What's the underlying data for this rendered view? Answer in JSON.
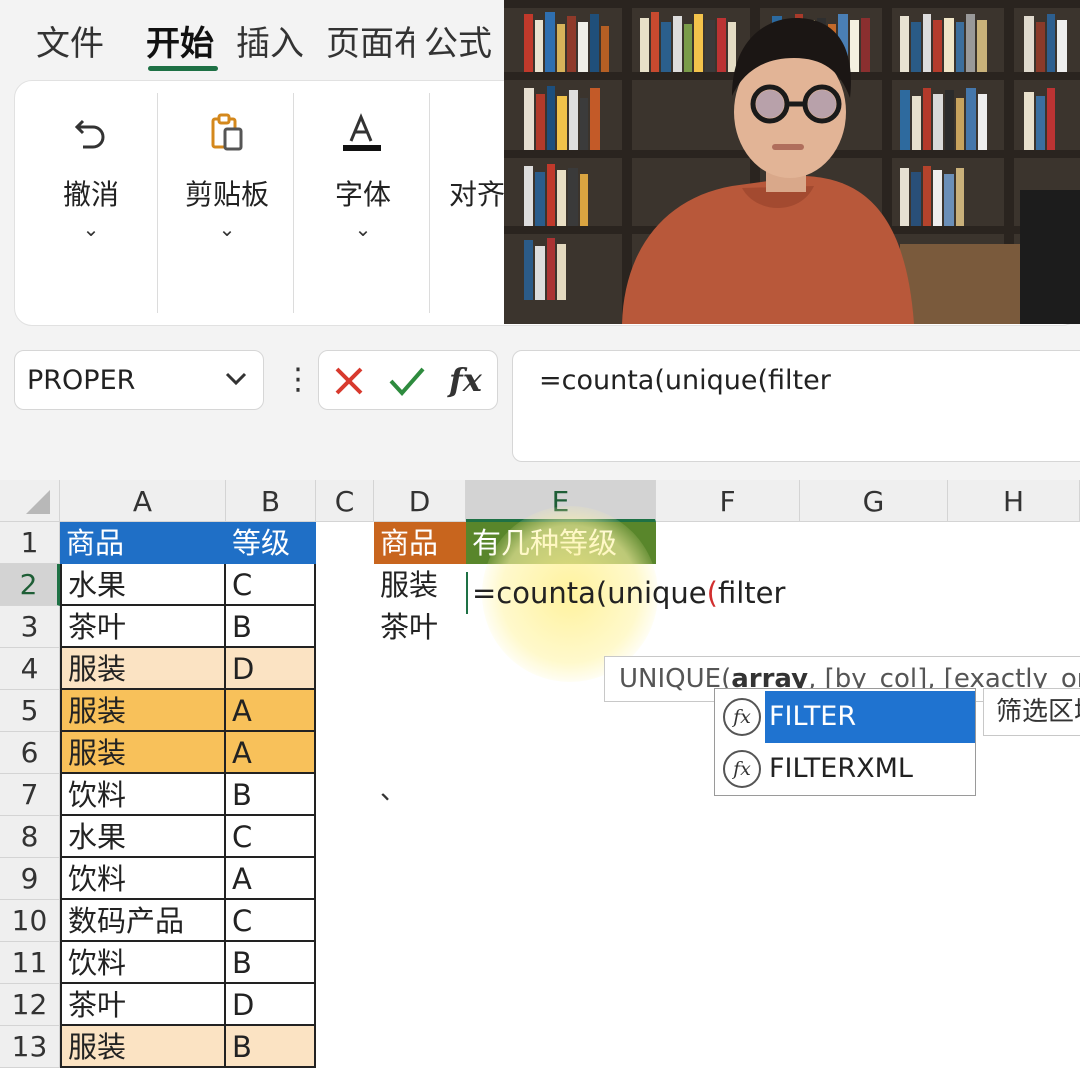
{
  "ribbon_tabs": [
    {
      "label": "文件"
    },
    {
      "label": "开始"
    },
    {
      "label": "插入"
    },
    {
      "label": "页面布"
    },
    {
      "label": "公式"
    }
  ],
  "ribbon_groups": [
    {
      "label": "撤消",
      "icon": "undo-icon"
    },
    {
      "label": "剪贴板",
      "icon": "clipboard-icon"
    },
    {
      "label": "字体",
      "icon": "font-color-icon"
    },
    {
      "label": "对齐",
      "icon": "align-icon"
    }
  ],
  "formula_bar": {
    "name_box": "PROPER",
    "cancel_icon": "cancel-icon",
    "enter_icon": "check-icon",
    "fx_label": "fx",
    "formula": "=counta(unique(filter"
  },
  "columns": [
    "A",
    "B",
    "C",
    "D",
    "E",
    "F",
    "G",
    "H"
  ],
  "rows": [
    "1",
    "2",
    "3",
    "4",
    "5",
    "6",
    "7",
    "8",
    "9",
    "10",
    "11",
    "12",
    "13"
  ],
  "table_ab": {
    "header": [
      "商品",
      "等级"
    ],
    "rows": [
      [
        "水果",
        "C"
      ],
      [
        "茶叶",
        "B"
      ],
      [
        "服装",
        "D"
      ],
      [
        "服装",
        "A"
      ],
      [
        "服装",
        "A"
      ],
      [
        "饮料",
        "B"
      ],
      [
        "水果",
        "C"
      ],
      [
        "饮料",
        "A"
      ],
      [
        "数码产品",
        "C"
      ],
      [
        "饮料",
        "B"
      ],
      [
        "茶叶",
        "D"
      ],
      [
        "服装",
        "B"
      ]
    ]
  },
  "table_de": {
    "header_d": "商品",
    "header_e": "有几种等级",
    "d_values": [
      "服装",
      "茶叶"
    ]
  },
  "editing_cell": {
    "part1": "=counta(unique",
    "paren": "(",
    "part2": "filter"
  },
  "autocomplete": {
    "tooltip_prefix": "UNIQUE(",
    "tooltip_bold": "array",
    "tooltip_rest": ", [by_col], [exactly_once])",
    "items": [
      "FILTER",
      "FILTERXML"
    ],
    "description": "筛选区域"
  },
  "stray_mark": "、",
  "colors": {
    "accent_green": "#1e7145",
    "header_blue": "#1f6fc6",
    "header_orange": "#c8651e",
    "header_green": "#59862b",
    "fill_light": "#fbe3c3",
    "fill_dark": "#f8c15a",
    "selection_blue": "#1f73d0"
  }
}
